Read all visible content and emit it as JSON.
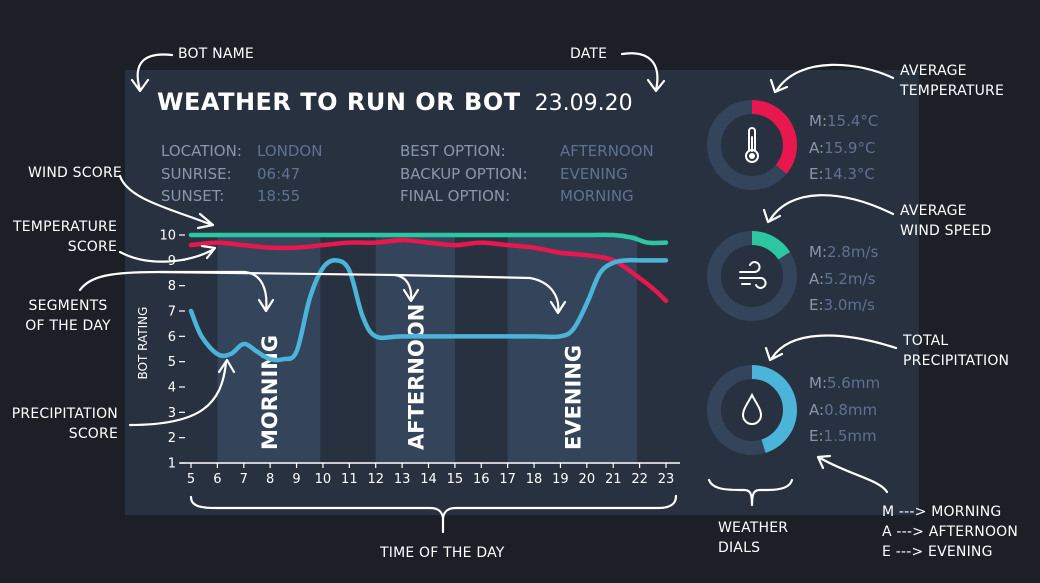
{
  "header": {
    "title": "WEATHER TO RUN OR BOT",
    "date": "23.09.20"
  },
  "info_left": [
    {
      "key": "LOCATION:",
      "value": "LONDON"
    },
    {
      "key": "SUNRISE:",
      "value": "06:47"
    },
    {
      "key": "SUNSET:",
      "value": "18:55"
    }
  ],
  "info_right": [
    {
      "key": "BEST OPTION:",
      "value": "AFTERNOON"
    },
    {
      "key": "BACKUP OPTION:",
      "value": "EVENING"
    },
    {
      "key": "FINAL OPTION:",
      "value": "MORNING"
    }
  ],
  "dials": [
    {
      "icon": "thermometer-icon",
      "fraction": 0.36,
      "color": "#e8174e",
      "rows": [
        {
          "key": "M:",
          "value": "15.4°C"
        },
        {
          "key": "A:",
          "value": "15.9°C"
        },
        {
          "key": "E:",
          "value": "14.3°C"
        }
      ]
    },
    {
      "icon": "wind-icon",
      "fraction": 0.16,
      "color": "#2cc7a0",
      "rows": [
        {
          "key": "M:",
          "value": "2.8m/s"
        },
        {
          "key": "A:",
          "value": "5.2m/s"
        },
        {
          "key": "E:",
          "value": "3.0m/s"
        }
      ]
    },
    {
      "icon": "droplet-icon",
      "fraction": 0.45,
      "color": "#4bb4d8",
      "rows": [
        {
          "key": "M:",
          "value": "5.6mm"
        },
        {
          "key": "A:",
          "value": "0.8mm"
        },
        {
          "key": "E:",
          "value": "1.5mm"
        }
      ]
    }
  ],
  "annotations": {
    "bot_name": "BOT NAME",
    "date": "DATE",
    "wind_score": "WIND SCORE",
    "temperature_score": [
      "TEMPERATURE",
      "SCORE"
    ],
    "segments": [
      "SEGMENTS",
      "OF THE DAY"
    ],
    "precipitation_score": [
      "PRECIPITATION",
      "SCORE"
    ],
    "time_of_day": "TIME OF THE DAY",
    "weather_dials": [
      "WEATHER",
      "DIALS"
    ],
    "average_temperature": [
      "AVERAGE",
      "TEMPERATURE"
    ],
    "average_wind_speed": [
      "AVERAGE",
      "WIND SPEED"
    ],
    "total_precipitation": [
      "TOTAL",
      "PRECIPITATION"
    ],
    "legend": [
      "M ---> MORNING",
      "A ---> AFTERNOON",
      "E ---> EVENING"
    ]
  },
  "chart_data": {
    "type": "line",
    "ylabel": "BOT RATING",
    "xlabel": "",
    "xlim": [
      5,
      23
    ],
    "ylim": [
      1,
      10
    ],
    "x_ticks": [
      5,
      6,
      7,
      8,
      9,
      10,
      11,
      12,
      13,
      14,
      15,
      16,
      17,
      18,
      19,
      20,
      21,
      22,
      23
    ],
    "y_ticks": [
      1,
      2,
      3,
      4,
      5,
      6,
      7,
      8,
      9,
      10
    ],
    "colors": {
      "wind": "#2cc7a0",
      "temperature": "#e8174e",
      "precipitation": "#4bb4d8",
      "segment": "#34445a"
    },
    "segments": [
      {
        "label": "MORNING",
        "start": 6.0,
        "end": 9.9
      },
      {
        "label": "AFTERNOON",
        "start": 12.0,
        "end": 15.0
      },
      {
        "label": "EVENING",
        "start": 17.0,
        "end": 21.9
      }
    ],
    "series": [
      {
        "key": "wind",
        "x": [
          5,
          6,
          8,
          10,
          12,
          14,
          16,
          18,
          20,
          21,
          21.7,
          22.3,
          23
        ],
        "values": [
          10.0,
          10.0,
          10.0,
          10.0,
          10.0,
          10.0,
          10.0,
          10.0,
          10.0,
          10.0,
          9.9,
          9.7,
          9.7
        ]
      },
      {
        "key": "temperature",
        "x": [
          5,
          6,
          7,
          8,
          9,
          10,
          11,
          12,
          13,
          14,
          15,
          16,
          17,
          18,
          19,
          20,
          21,
          22,
          22.6,
          23
        ],
        "values": [
          9.6,
          9.7,
          9.6,
          9.5,
          9.5,
          9.6,
          9.7,
          9.7,
          9.8,
          9.7,
          9.6,
          9.7,
          9.6,
          9.5,
          9.3,
          9.2,
          9.0,
          8.3,
          7.8,
          7.4
        ]
      },
      {
        "key": "precipitation",
        "x": [
          5,
          5.4,
          6,
          6.5,
          7,
          7.5,
          8,
          8.5,
          9,
          9.5,
          10,
          10.5,
          11,
          11.5,
          12,
          13,
          15,
          17,
          18,
          19,
          19.5,
          20,
          20.5,
          21,
          21.5,
          22,
          23
        ],
        "values": [
          7.0,
          6.0,
          5.3,
          5.3,
          5.7,
          5.4,
          5.1,
          5.1,
          5.4,
          7.5,
          8.7,
          9.0,
          8.6,
          6.8,
          6.0,
          6.0,
          6.0,
          6.0,
          6.0,
          6.0,
          6.3,
          7.3,
          8.5,
          8.9,
          9.0,
          9.0,
          9.0
        ]
      }
    ]
  }
}
